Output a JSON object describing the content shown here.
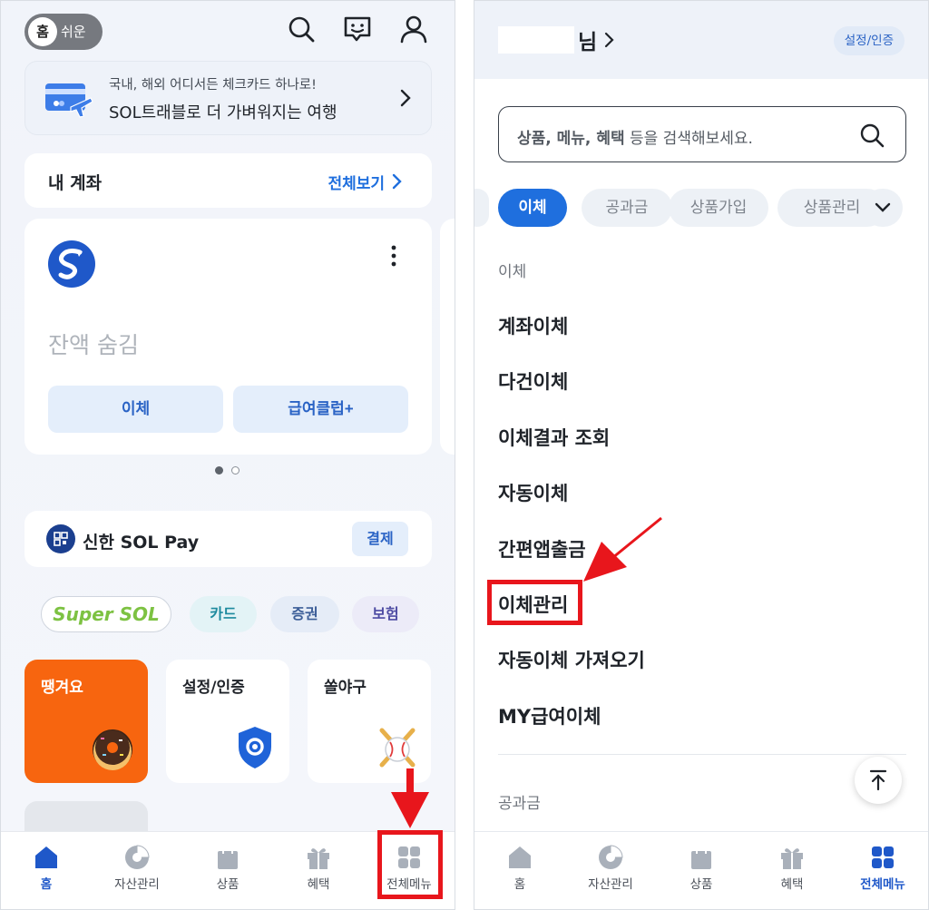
{
  "left": {
    "mode_toggle": {
      "home": "홈",
      "easy": "쉬운"
    },
    "top_icons": [
      "search-icon",
      "chat-bot-icon",
      "profile-icon"
    ],
    "banner": {
      "subtitle": "국내, 해외 어디서든 체크카드 하나로!",
      "title": "SOL트래블로 더 가벼워지는 여행"
    },
    "accounts": {
      "title": "내 계좌",
      "view_all": "전체보기"
    },
    "account_card": {
      "balance": "잔액 숨김",
      "transfer_button": "이체",
      "salary_button": "급여클럽+"
    },
    "solpay": {
      "label": "신한 SOL Pay",
      "pay_button": "결제"
    },
    "pills": {
      "supersol": "Super SOL",
      "card": "카드",
      "securities": "증권",
      "insurance": "보험"
    },
    "tiles": [
      {
        "label": "땡겨요",
        "icon": "donut-icon"
      },
      {
        "label": "설정/인증",
        "icon": "shield-gear-icon"
      },
      {
        "label": "쏠야구",
        "icon": "baseball-icon"
      }
    ],
    "nav": [
      {
        "label": "홈",
        "icon": "home-icon"
      },
      {
        "label": "자산관리",
        "icon": "pie-chart-icon"
      },
      {
        "label": "상품",
        "icon": "shopping-bag-icon"
      },
      {
        "label": "혜택",
        "icon": "gift-icon"
      },
      {
        "label": "전체메뉴",
        "icon": "grid-icon"
      }
    ]
  },
  "right": {
    "header": {
      "name_suffix": "님",
      "settings": "설정/인증"
    },
    "search": {
      "placeholder_bold": "상품, 메뉴, 혜택",
      "placeholder_rest": " 등을 검색해보세요."
    },
    "chips": [
      "이체",
      "공과금",
      "상품가입",
      "상품관리"
    ],
    "section": "이체",
    "menu": [
      "계좌이체",
      "다건이체",
      "이체결과 조회",
      "자동이체",
      "간편앱출금",
      "이체관리",
      "자동이체 가져오기",
      "MY급여이체"
    ],
    "next_section": "공과금",
    "nav": [
      {
        "label": "홈",
        "icon": "home-icon"
      },
      {
        "label": "자산관리",
        "icon": "pie-chart-icon"
      },
      {
        "label": "상품",
        "icon": "shopping-bag-icon"
      },
      {
        "label": "혜택",
        "icon": "gift-icon"
      },
      {
        "label": "전체메뉴",
        "icon": "grid-icon"
      }
    ]
  },
  "colors": {
    "accent": "#1f6fde",
    "highlight": "#e8161c",
    "orange_tile": "#f7650f"
  }
}
